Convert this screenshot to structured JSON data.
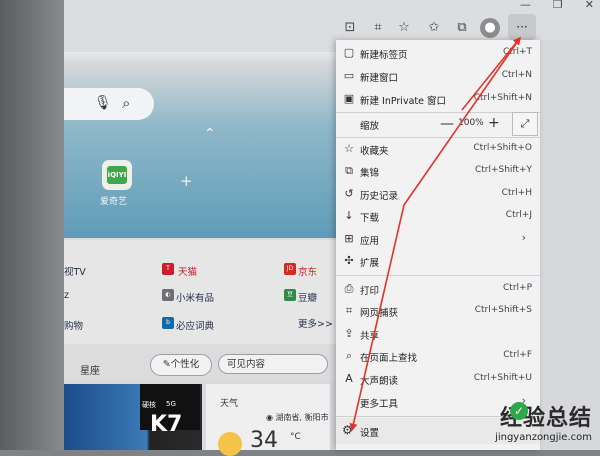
{
  "toolbar": {
    "more_label": "···"
  },
  "page": {
    "iqiyi_logo": "iQIYI",
    "iqiyi_label": "爱奇艺",
    "add_label": "+",
    "links": [
      {
        "label": "视TV"
      },
      {
        "label": "天猫",
        "badge": "T",
        "color": "#cc1f2b"
      },
      {
        "label": "京东",
        "badge": "JD",
        "color": "#d32b1e"
      },
      {
        "label": "z"
      },
      {
        "label": "小米有品",
        "badge": "◐",
        "color": "#6d6f74"
      },
      {
        "label": "豆瓣",
        "badge": "豆",
        "color": "#2f8a45"
      },
      {
        "label": "购物"
      },
      {
        "label": "必应词典",
        "badge": "b",
        "color": "#0e6aa8"
      },
      {
        "label": "更多>>"
      }
    ],
    "tab_label": "星座",
    "personalize_label": "个性化",
    "visible_label": "可见内容",
    "phone_tag": "5G",
    "phone_model": "K7",
    "phone_prefix": "硬核",
    "weather_title": "天气",
    "weather_location": "湖南省, 衡阳市",
    "temperature": "34",
    "temperature_unit": "°C"
  },
  "menu": {
    "items": [
      {
        "icon": "new-tab-icon",
        "glyph": "▢",
        "label": "新建标签页",
        "shortcut": "Ctrl+T"
      },
      {
        "icon": "new-window-icon",
        "glyph": "▭",
        "label": "新建窗口",
        "shortcut": "Ctrl+N"
      },
      {
        "icon": "inprivate-icon",
        "glyph": "▣",
        "label": "新建 InPrivate 窗口",
        "shortcut": "Ctrl+Shift+N"
      },
      {
        "icon": "favorites-icon",
        "glyph": "☆",
        "label": "收藏夹",
        "shortcut": "Ctrl+Shift+O"
      },
      {
        "icon": "collections-icon",
        "glyph": "⧉",
        "label": "集锦",
        "shortcut": "Ctrl+Shift+Y"
      },
      {
        "icon": "history-icon",
        "glyph": "↺",
        "label": "历史记录",
        "shortcut": "Ctrl+H"
      },
      {
        "icon": "downloads-icon",
        "glyph": "↓",
        "label": "下载",
        "shortcut": "Ctrl+J"
      },
      {
        "icon": "apps-icon",
        "glyph": "⊞",
        "label": "应用",
        "shortcut": "",
        "chevron": "›"
      },
      {
        "icon": "extensions-icon",
        "glyph": "✣",
        "label": "扩展",
        "shortcut": ""
      },
      {
        "icon": "print-icon",
        "glyph": "⎙",
        "label": "打印",
        "shortcut": "Ctrl+P"
      },
      {
        "icon": "web-capture-icon",
        "glyph": "⌗",
        "label": "网页捕获",
        "shortcut": "Ctrl+Shift+S"
      },
      {
        "icon": "share-icon",
        "glyph": "⇪",
        "label": "共享",
        "shortcut": ""
      },
      {
        "icon": "find-icon",
        "glyph": "⌕",
        "label": "在页面上查找",
        "shortcut": "Ctrl+F"
      },
      {
        "icon": "read-aloud-icon",
        "glyph": "A",
        "label": "大声朗读",
        "shortcut": "Ctrl+Shift+U"
      },
      {
        "icon": "more-tools-icon",
        "glyph": "",
        "label": "更多工具",
        "shortcut": "",
        "chevron": "›"
      },
      {
        "icon": "settings-icon",
        "glyph": "⚙",
        "label": "设置",
        "shortcut": ""
      }
    ],
    "zoom_label": "缩放",
    "zoom_minus": "—",
    "zoom_value": "100%",
    "zoom_plus": "+",
    "zoom_full": "⤢"
  },
  "watermark": {
    "title": "经验总结",
    "url": "jingyanzongjie.com",
    "check": "✓"
  },
  "colors": {
    "annotation": "#e2332b"
  }
}
